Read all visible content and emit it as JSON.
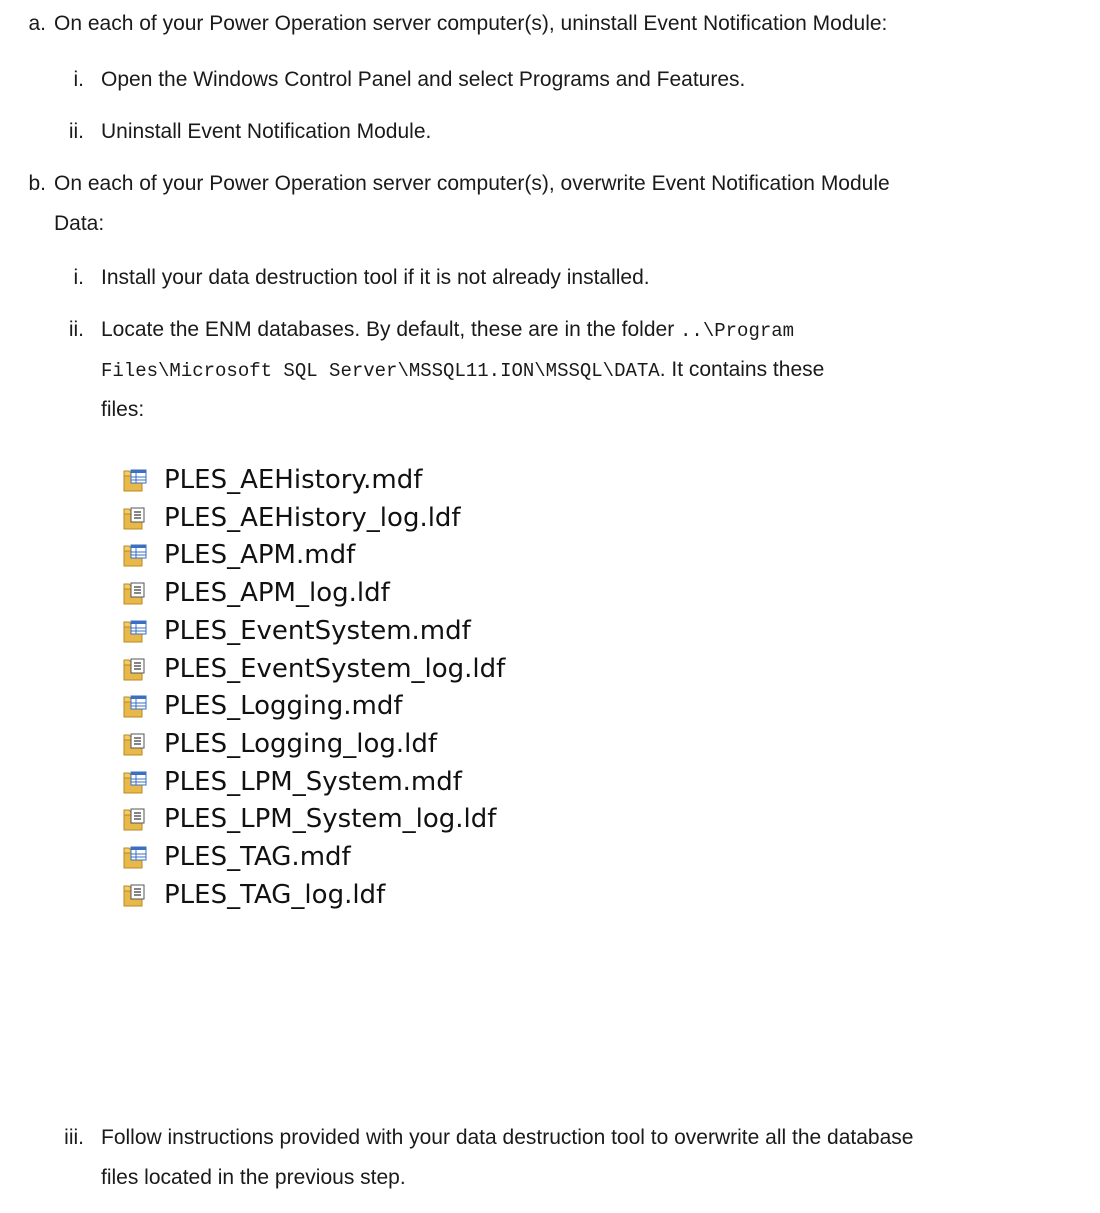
{
  "steps": {
    "a": {
      "marker": "a.",
      "text": "On each of your Power Operation server computer(s), uninstall Event Notification Module:",
      "sub": [
        {
          "marker": "i.",
          "text": "Open the Windows Control Panel and select Programs and Features."
        },
        {
          "marker": "ii.",
          "text": "Uninstall Event Notification Module."
        }
      ]
    },
    "b": {
      "marker": "b.",
      "line1": "On each of your Power Operation server computer(s), overwrite Event Notification Module",
      "line2": "Data:",
      "sub_i": {
        "marker": "i.",
        "text": "Install your data destruction tool if it is not already installed."
      },
      "sub_ii": {
        "marker": "ii.",
        "text1": "Locate the ENM databases. By default, these are in the folder ",
        "path1": "..\\Program",
        "path2": "Files\\Microsoft SQL Server\\MSSQL11.ION\\MSSQL\\DATA",
        "text2": ". It contains these",
        "text3": "files:"
      },
      "files": [
        {
          "name": "PLES_AEHistory.mdf",
          "icon": "database-file-icon"
        },
        {
          "name": "PLES_AEHistory_log.ldf",
          "icon": "log-file-icon"
        },
        {
          "name": "PLES_APM.mdf",
          "icon": "database-file-icon"
        },
        {
          "name": "PLES_APM_log.ldf",
          "icon": "log-file-icon"
        },
        {
          "name": "PLES_EventSystem.mdf",
          "icon": "database-file-icon"
        },
        {
          "name": "PLES_EventSystem_log.ldf",
          "icon": "log-file-icon"
        },
        {
          "name": "PLES_Logging.mdf",
          "icon": "database-file-icon"
        },
        {
          "name": "PLES_Logging_log.ldf",
          "icon": "log-file-icon"
        },
        {
          "name": "PLES_LPM_System.mdf",
          "icon": "database-file-icon"
        },
        {
          "name": "PLES_LPM_System_log.ldf",
          "icon": "log-file-icon"
        },
        {
          "name": "PLES_TAG.mdf",
          "icon": "database-file-icon"
        },
        {
          "name": "PLES_TAG_log.ldf",
          "icon": "log-file-icon"
        }
      ],
      "sub_iii": {
        "marker": "iii.",
        "line1": "Follow instructions provided with your data destruction tool to overwrite all the database",
        "line2": "files located in the previous step."
      }
    }
  },
  "colors": {
    "text": "#1a1a1a",
    "folder": "#e8b84a",
    "table_blue": "#3a6fc4"
  }
}
